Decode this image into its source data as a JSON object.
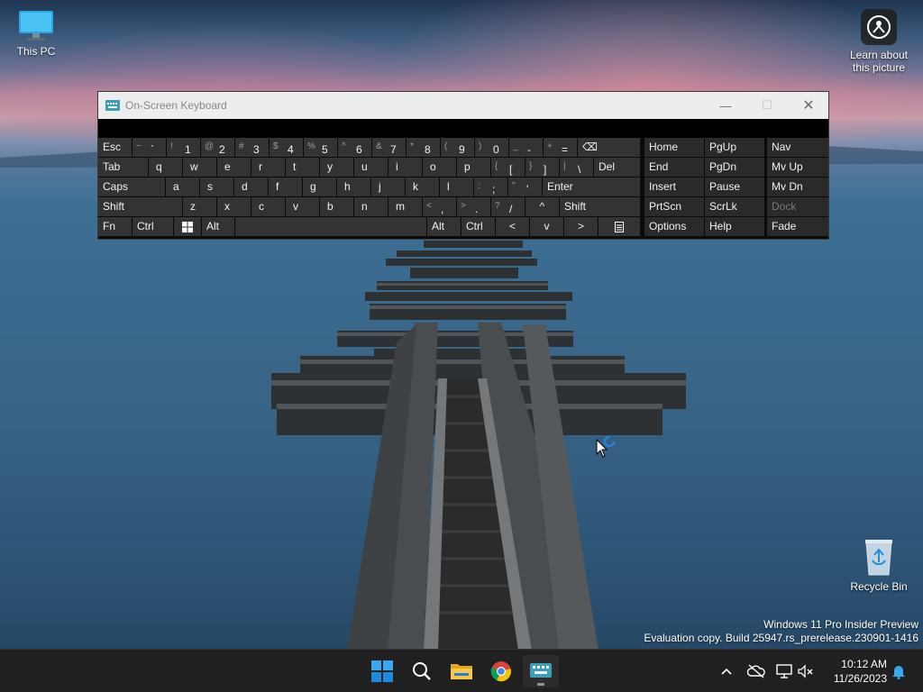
{
  "desktop": {
    "icons": [
      {
        "label": "This PC",
        "icon": "monitor-icon"
      },
      {
        "label": "Learn about this picture",
        "icon": "camera-info-icon"
      },
      {
        "label": "Recycle Bin",
        "icon": "recycle-bin-icon"
      }
    ]
  },
  "watermark": {
    "line1": "Windows 11 Pro Insider Preview",
    "line2": "Evaluation copy. Build 25947.rs_prerelease.230901-1416"
  },
  "osk": {
    "title": "On-Screen Keyboard",
    "controls": {
      "minimize": "—",
      "maximize": "☐",
      "close": "✕"
    },
    "row1": [
      {
        "label": "Esc"
      },
      {
        "shift": "~",
        "main": "`"
      },
      {
        "shift": "!",
        "main": "1"
      },
      {
        "shift": "@",
        "main": "2"
      },
      {
        "shift": "#",
        "main": "3"
      },
      {
        "shift": "$",
        "main": "4"
      },
      {
        "shift": "%",
        "main": "5"
      },
      {
        "shift": "^",
        "main": "6"
      },
      {
        "shift": "&",
        "main": "7"
      },
      {
        "shift": "*",
        "main": "8"
      },
      {
        "shift": "(",
        "main": "9"
      },
      {
        "shift": ")",
        "main": "0"
      },
      {
        "shift": "_",
        "main": "-"
      },
      {
        "shift": "+",
        "main": "="
      },
      {
        "label": "⌫"
      }
    ],
    "row2": [
      {
        "label": "Tab"
      },
      {
        "label": "q"
      },
      {
        "label": "w"
      },
      {
        "label": "e"
      },
      {
        "label": "r"
      },
      {
        "label": "t"
      },
      {
        "label": "y"
      },
      {
        "label": "u"
      },
      {
        "label": "i"
      },
      {
        "label": "o"
      },
      {
        "label": "p"
      },
      {
        "shift": "{",
        "main": "["
      },
      {
        "shift": "}",
        "main": "]"
      },
      {
        "shift": "|",
        "main": "\\"
      },
      {
        "label": "Del"
      }
    ],
    "row3": [
      {
        "label": "Caps"
      },
      {
        "label": "a"
      },
      {
        "label": "s"
      },
      {
        "label": "d"
      },
      {
        "label": "f"
      },
      {
        "label": "g"
      },
      {
        "label": "h"
      },
      {
        "label": "j"
      },
      {
        "label": "k"
      },
      {
        "label": "l"
      },
      {
        "shift": ":",
        "main": ";"
      },
      {
        "shift": "\"",
        "main": "'"
      },
      {
        "label": "Enter"
      }
    ],
    "row4": [
      {
        "label": "Shift"
      },
      {
        "label": "z"
      },
      {
        "label": "x"
      },
      {
        "label": "c"
      },
      {
        "label": "v"
      },
      {
        "label": "b"
      },
      {
        "label": "n"
      },
      {
        "label": "m"
      },
      {
        "shift": "<",
        "main": ","
      },
      {
        "shift": ">",
        "main": "."
      },
      {
        "shift": "?",
        "main": "/"
      },
      {
        "label": "^"
      },
      {
        "label": "Shift"
      }
    ],
    "row5": [
      {
        "label": "Fn"
      },
      {
        "label": "Ctrl"
      },
      {
        "label": "windows-logo-icon"
      },
      {
        "label": "Alt"
      },
      {
        "label": ""
      },
      {
        "label": "Alt"
      },
      {
        "label": "Ctrl"
      },
      {
        "label": "<"
      },
      {
        "label": "v"
      },
      {
        "label": ">"
      },
      {
        "label": "menu-icon"
      }
    ],
    "nav_keys": [
      [
        "Home",
        "PgUp",
        "Nav"
      ],
      [
        "End",
        "PgDn",
        "Mv Up"
      ],
      [
        "Insert",
        "Pause",
        "Mv Dn"
      ],
      [
        "PrtScn",
        "ScrLk",
        "Dock"
      ],
      [
        "Options",
        "Help",
        "Fade"
      ]
    ]
  },
  "taskbar": {
    "apps": [
      {
        "name": "Start",
        "icon": "windows-start-icon"
      },
      {
        "name": "Search",
        "icon": "search-icon"
      },
      {
        "name": "File Explorer",
        "icon": "folder-icon"
      },
      {
        "name": "Chrome",
        "icon": "chrome-icon"
      },
      {
        "name": "On-Screen Keyboard",
        "icon": "keyboard-icon"
      }
    ],
    "tray": {
      "icons": [
        "chevron-up-icon",
        "cloud-off-icon",
        "network-icon",
        "volume-muted-icon",
        "notification-bell-icon"
      ]
    },
    "clock": {
      "time": "10:12 AM",
      "date": "11/26/2023"
    }
  },
  "colors": {
    "taskbar_bg": "#202020",
    "osk_key": "#333333",
    "osk_bg": "#0a0a0a",
    "accent": "#0078d4"
  }
}
